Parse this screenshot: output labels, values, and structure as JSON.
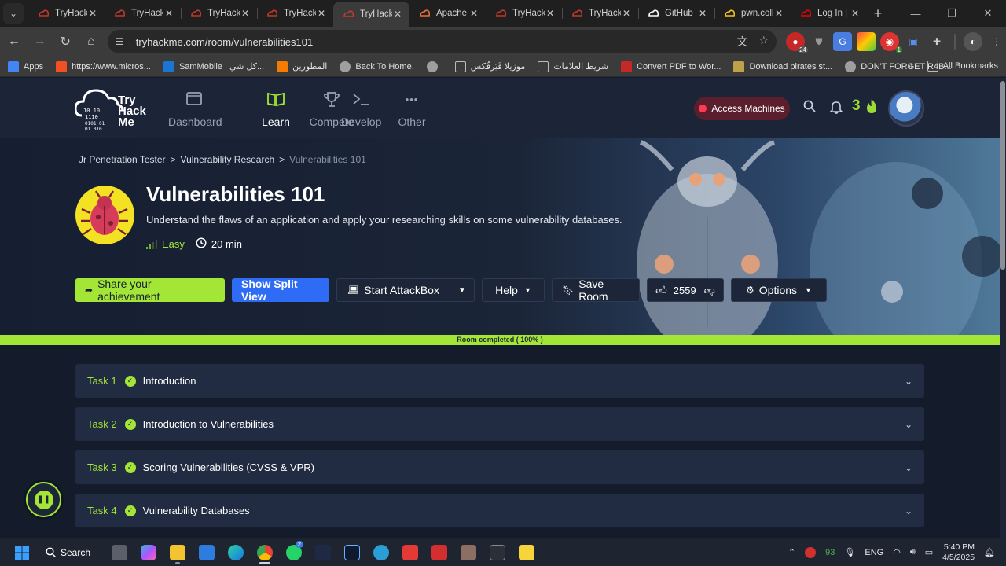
{
  "browser": {
    "tabs": [
      {
        "title": "TryHackM",
        "favicon": "thm-icon",
        "color": "#c0392b"
      },
      {
        "title": "TryHackM",
        "favicon": "thm-icon",
        "color": "#c0392b"
      },
      {
        "title": "TryHackM",
        "favicon": "thm-icon",
        "color": "#c0392b"
      },
      {
        "title": "TryHackM",
        "favicon": "thm-icon",
        "color": "#c0392b"
      },
      {
        "title": "TryHackM",
        "favicon": "thm-icon",
        "color": "#c0392b"
      },
      {
        "title": "Apache",
        "favicon": "apache-icon",
        "color": "#e8713b"
      },
      {
        "title": "TryHackM",
        "favicon": "thm-icon",
        "color": "#c0392b"
      },
      {
        "title": "TryHackM",
        "favicon": "thm-icon",
        "color": "#c0392b"
      },
      {
        "title": "GitHub",
        "favicon": "github-icon",
        "color": "#ffffff"
      },
      {
        "title": "pwn.coll",
        "favicon": "pwn-icon",
        "color": "#f5c518"
      },
      {
        "title": "Log In |",
        "favicon": "redhat-icon",
        "color": "#e00"
      }
    ],
    "active_tab_index": 4,
    "url": "tryhackme.com/room/vulnerabilities101",
    "extension_badge": "24",
    "extension_badge2": "1",
    "bookmarks": [
      {
        "label": "Apps",
        "icon": "apps-grid-icon"
      },
      {
        "label": "https://www.micros...",
        "icon": "microsoft-icon"
      },
      {
        "label": "SamMobile | كل شي...",
        "icon": "sammobile-icon"
      },
      {
        "label": "المطورين",
        "icon": "blogger-icon"
      },
      {
        "label": "Back To Home.",
        "icon": "globe-icon"
      },
      {
        "label": "",
        "icon": "globe-icon"
      },
      {
        "label": "موزيلا فَيَرفُكس",
        "icon": "folder-icon"
      },
      {
        "label": "شريط العلامات",
        "icon": "folder-icon"
      },
      {
        "label": "Convert PDF to Wor...",
        "icon": "pdf-icon"
      },
      {
        "label": "Download pirates st...",
        "icon": "shield-icon"
      },
      {
        "label": "DON'T FORGET R4B...",
        "icon": "globe-icon"
      }
    ],
    "all_bookmarks": "All Bookmarks"
  },
  "site": {
    "logo_text": [
      "Try",
      "Hack",
      "Me"
    ],
    "logo_binary": "10 10\n1110\n0101 01\n01 010",
    "nav": [
      {
        "label": "Dashboard",
        "icon": "dashboard-icon"
      },
      {
        "label": "Learn",
        "icon": "book-icon"
      },
      {
        "label": "Compete",
        "icon": "trophy-icon"
      },
      {
        "label": "Develop",
        "icon": "terminal-icon"
      },
      {
        "label": "Other",
        "icon": "dots-icon"
      }
    ],
    "active_nav": "Learn",
    "access_machines": "Access Machines",
    "streak": "3"
  },
  "room": {
    "breadcrumb": [
      "Jr Penetration Tester",
      "Vulnerability Research",
      "Vulnerabilities 101"
    ],
    "title": "Vulnerabilities 101",
    "description": "Understand the flaws of an application and apply your researching skills on some vulnerability databases.",
    "difficulty": "Easy",
    "duration": "20 min",
    "actions": {
      "share": "Share your achievement",
      "split": "Show Split View",
      "attackbox": "Start AttackBox",
      "help": "Help",
      "save": "Save Room",
      "likes": "2559",
      "options": "Options"
    },
    "progress_text": "Room completed ( 100% )",
    "progress_value": 100
  },
  "tasks": [
    {
      "num": "Task 1",
      "title": "Introduction"
    },
    {
      "num": "Task 2",
      "title": "Introduction to Vulnerabilities"
    },
    {
      "num": "Task 3",
      "title": "Scoring Vulnerabilities (CVSS & VPR)"
    },
    {
      "num": "Task 4",
      "title": "Vulnerability Databases"
    }
  ],
  "taskbar": {
    "search": "Search",
    "badge_whatsapp": "2",
    "tray_number": "93",
    "lang": "ENG",
    "time": "5:40 PM",
    "date": "4/5/2025"
  },
  "colors": {
    "accent_green": "#a3e635",
    "accent_blue": "#2e6cf5",
    "access_red": "#ff3b53"
  }
}
